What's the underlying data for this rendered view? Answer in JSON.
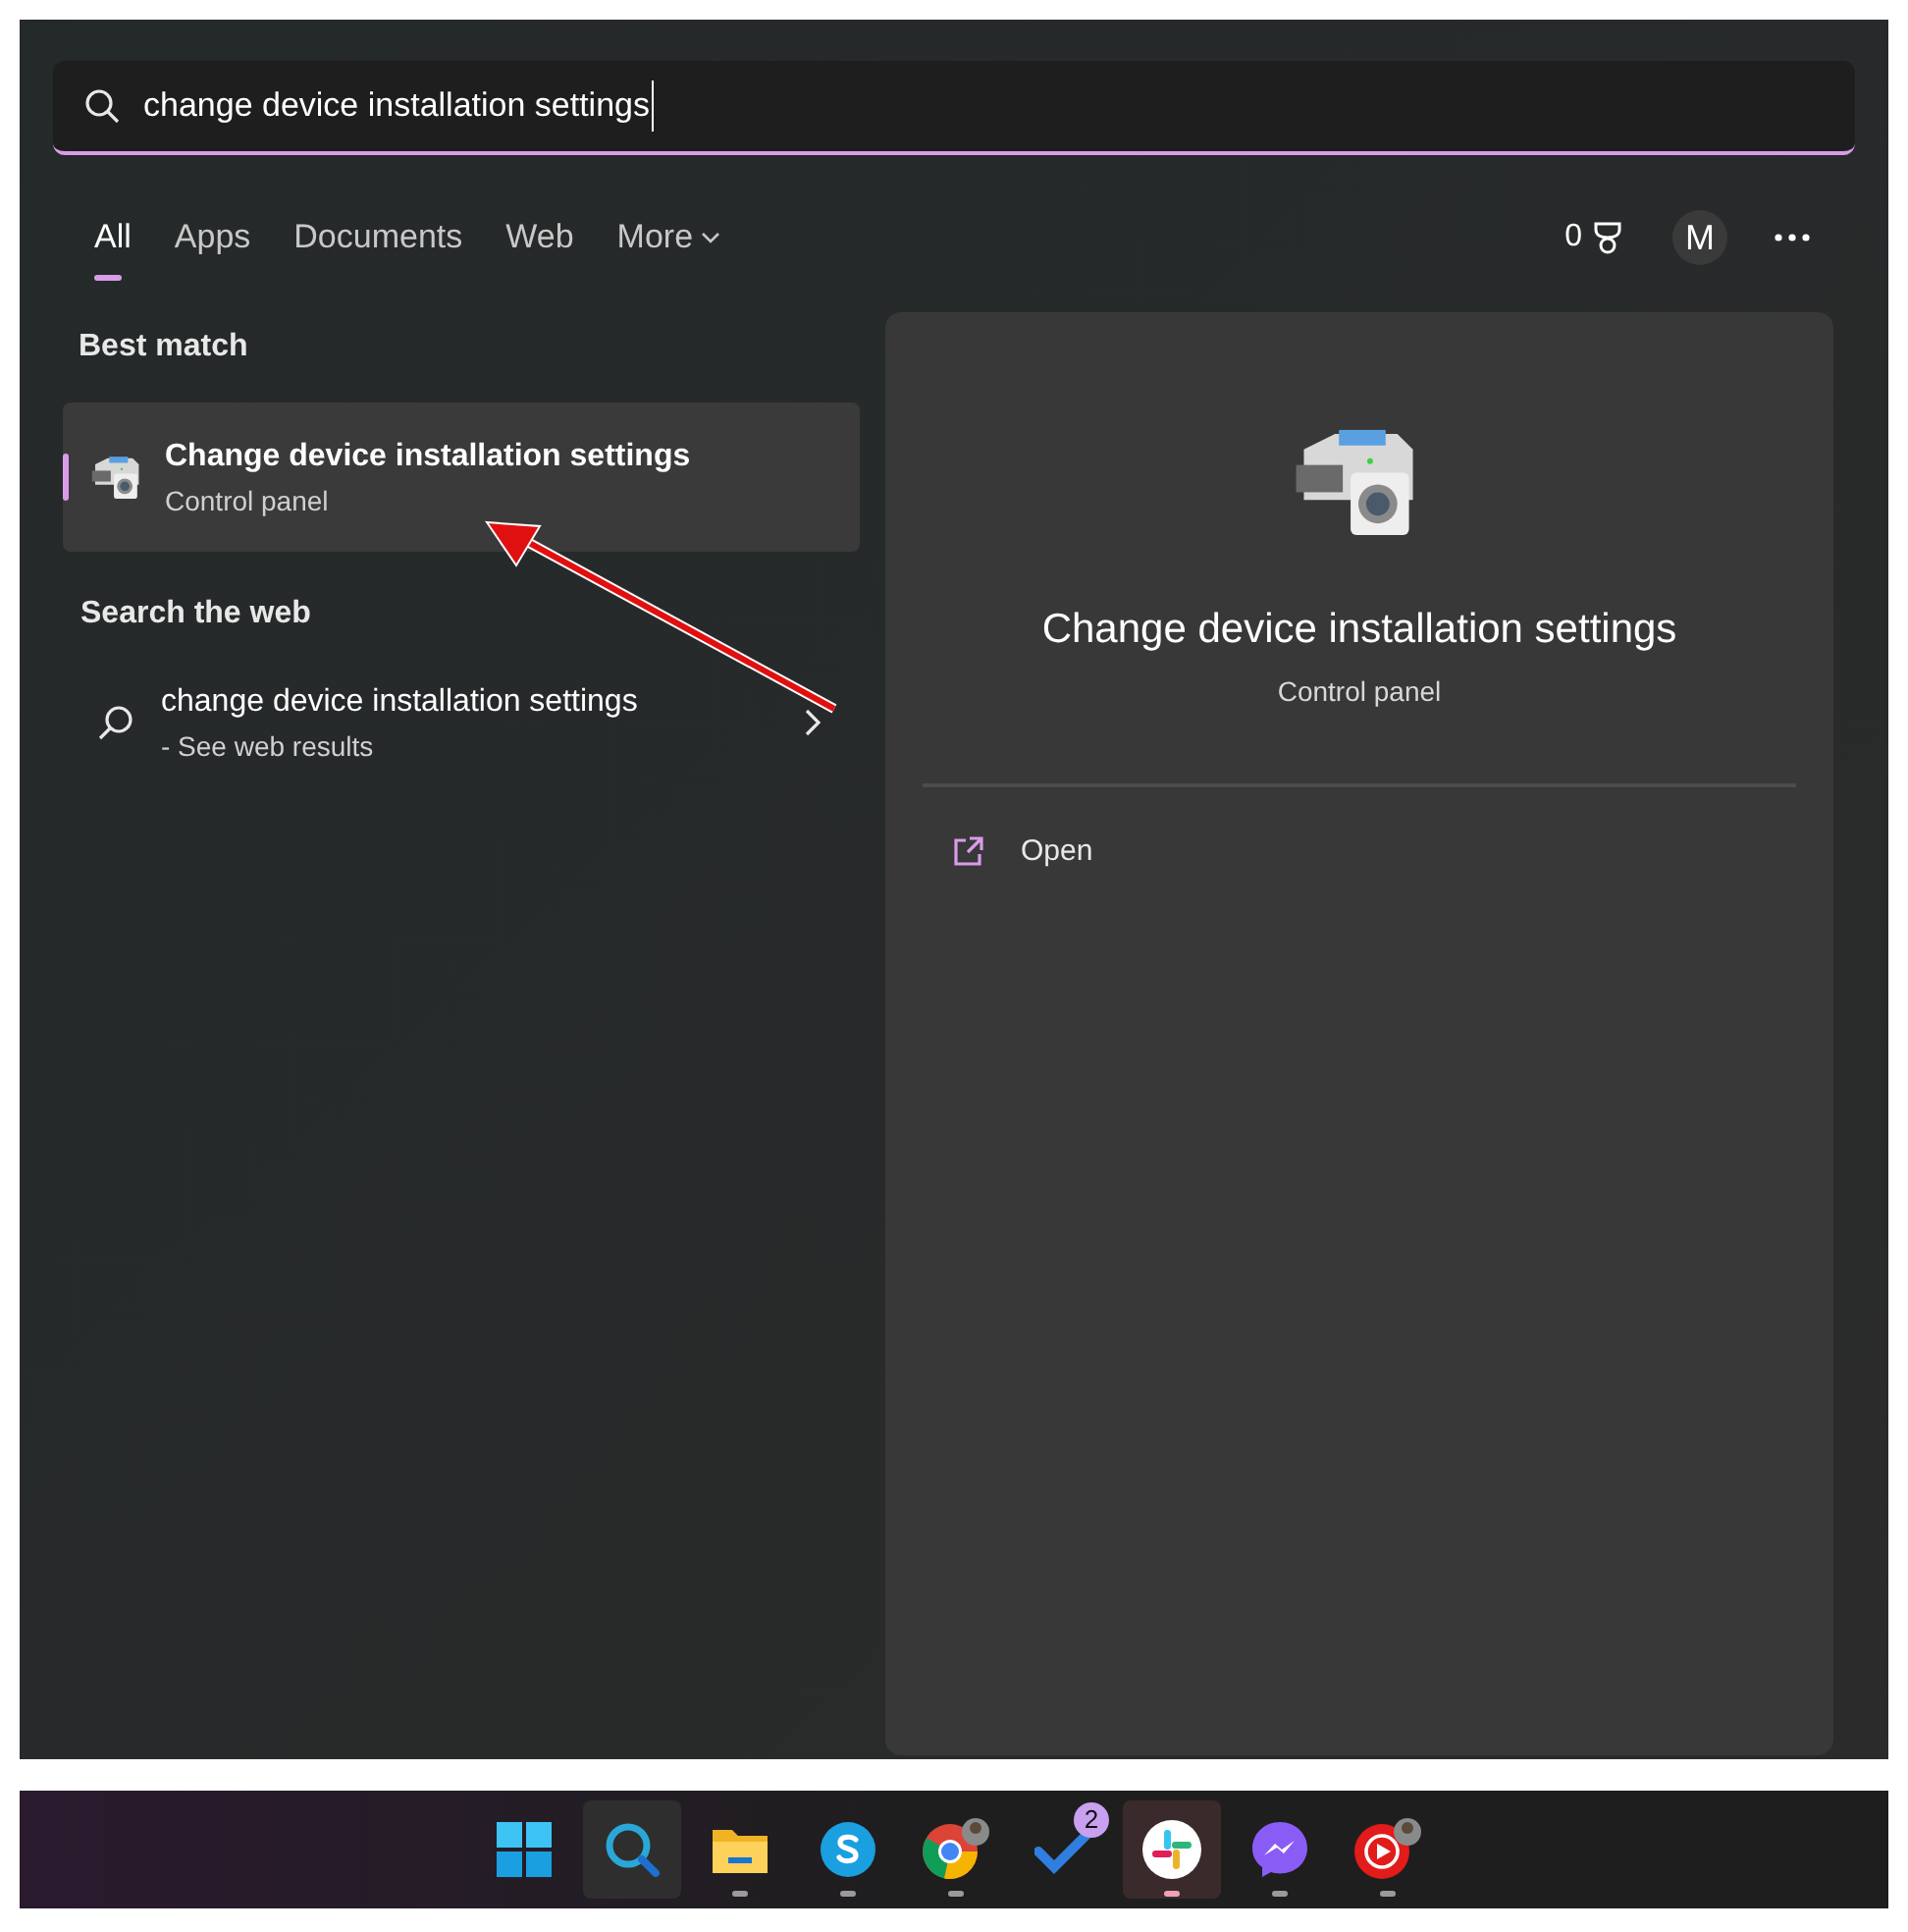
{
  "search": {
    "value": "change device installation settings"
  },
  "tabs": [
    {
      "label": "All",
      "selected": true,
      "has_menu": false
    },
    {
      "label": "Apps",
      "selected": false,
      "has_menu": false
    },
    {
      "label": "Documents",
      "selected": false,
      "has_menu": false
    },
    {
      "label": "Web",
      "selected": false,
      "has_menu": false
    },
    {
      "label": "More",
      "selected": false,
      "has_menu": true
    }
  ],
  "header_right": {
    "rewards": "0",
    "avatar": "M"
  },
  "best_match": {
    "heading": "Best match",
    "item": {
      "title": "Change device installation settings",
      "subtitle": "Control panel",
      "selected": true
    }
  },
  "search_the_web": {
    "heading": "Search the web",
    "item": {
      "title": "change device installation settings",
      "subtitle": "- See web results"
    }
  },
  "preview": {
    "title": "Change device installation settings",
    "subtitle": "Control panel",
    "actions": [
      {
        "label": "Open"
      }
    ]
  },
  "taskbar": [
    {
      "kind": "start",
      "selected": false,
      "running": false
    },
    {
      "kind": "search",
      "selected": true,
      "running": false
    },
    {
      "kind": "files",
      "selected": false,
      "running": true
    },
    {
      "kind": "skype",
      "selected": false,
      "running": true
    },
    {
      "kind": "chrome",
      "selected": false,
      "running": true
    },
    {
      "kind": "todo",
      "selected": false,
      "running": false,
      "badge": "2"
    },
    {
      "kind": "slack",
      "selected": true,
      "running": true
    },
    {
      "kind": "messenger",
      "selected": false,
      "running": true
    },
    {
      "kind": "ytmusic",
      "selected": false,
      "running": true
    }
  ]
}
